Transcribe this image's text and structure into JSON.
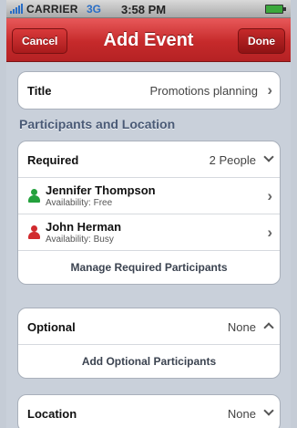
{
  "status": {
    "carrier": "CARRIER",
    "network": "3G",
    "time": "3:58 PM"
  },
  "nav": {
    "cancel": "Cancel",
    "title": "Add Event",
    "done": "Done"
  },
  "title_row": {
    "label": "Title",
    "value": "Promotions planning"
  },
  "section": {
    "participants_header": "Participants and Location"
  },
  "required": {
    "label": "Required",
    "value": "2 People",
    "people": [
      {
        "name": "Jennifer Thompson",
        "availability": "Availability: Free",
        "status": "free"
      },
      {
        "name": "John Herman",
        "availability": "Availability: Busy",
        "status": "busy"
      }
    ],
    "manage": "Manage Required Participants"
  },
  "optional": {
    "label": "Optional",
    "value": "None",
    "add": "Add Optional Participants"
  },
  "location": {
    "label": "Location",
    "value": "None"
  },
  "colors": {
    "nav_red": "#c62a2b",
    "free": "#24a13d",
    "busy": "#d12a2e",
    "section_text": "#4a5a76"
  }
}
